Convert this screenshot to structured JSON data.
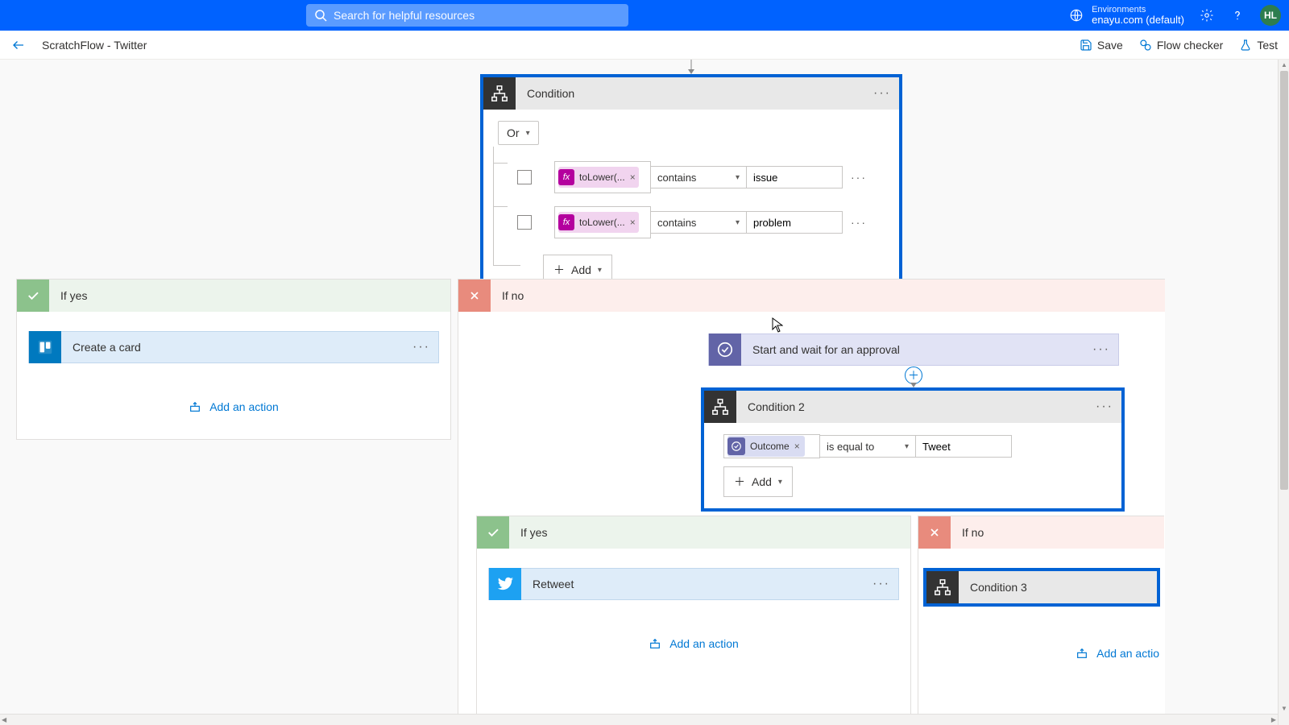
{
  "topbar": {
    "search_placeholder": "Search for helpful resources",
    "env_label": "Environments",
    "env_name": "enayu.com (default)",
    "avatar": "HL"
  },
  "cmdbar": {
    "title": "ScratchFlow - Twitter",
    "save": "Save",
    "flow_checker": "Flow checker",
    "test": "Test"
  },
  "condition1": {
    "title": "Condition",
    "logic": "Or",
    "rows": [
      {
        "pill": "toLower(...",
        "op": "contains",
        "val": "issue"
      },
      {
        "pill": "toLower(...",
        "op": "contains",
        "val": "problem"
      }
    ],
    "add": "Add"
  },
  "branches": {
    "yes": "If yes",
    "no": "If no"
  },
  "yes1": {
    "action": "Create a card",
    "add_action": "Add an action"
  },
  "no1": {
    "action": "Start and wait for an approval"
  },
  "condition2": {
    "title": "Condition 2",
    "pill": "Outcome",
    "op": "is equal to",
    "val": "Tweet",
    "add": "Add"
  },
  "yes2": {
    "action": "Retweet",
    "add_action": "Add an action"
  },
  "no2": {
    "action": "Condition 3",
    "add_action": "Add an actio"
  }
}
